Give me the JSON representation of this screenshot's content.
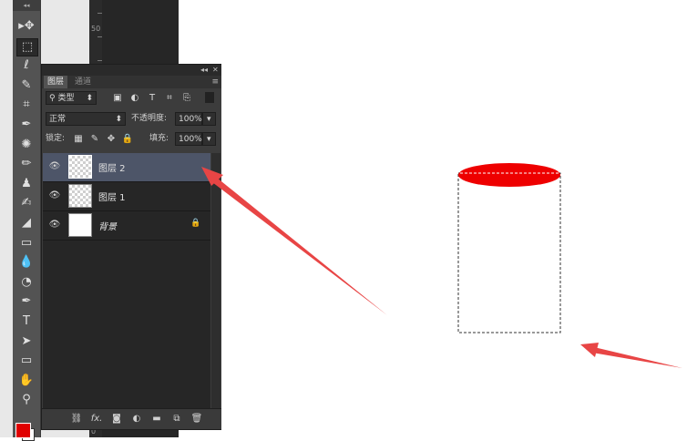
{
  "ruler": {
    "label": "50",
    "label_bottom": "0"
  },
  "toolbar": {
    "grip": "◂◂",
    "tools": [
      {
        "name": "move-tool",
        "icon": "move-icon",
        "glyph": "▸✥"
      },
      {
        "name": "marquee-tool",
        "icon": "rect-marquee-icon",
        "glyph": "⬚",
        "active": true
      },
      {
        "name": "lasso-tool",
        "icon": "lasso-icon",
        "glyph": "ℓ"
      },
      {
        "name": "quick-select-tool",
        "icon": "quick-select-icon",
        "glyph": "✎"
      },
      {
        "name": "crop-tool",
        "icon": "crop-icon",
        "glyph": "⌗"
      },
      {
        "name": "eyedropper-tool",
        "icon": "eyedropper-icon",
        "glyph": "✒"
      },
      {
        "name": "healing-tool",
        "icon": "healing-icon",
        "glyph": "✺"
      },
      {
        "name": "brush-tool",
        "icon": "brush-icon",
        "glyph": "✏"
      },
      {
        "name": "stamp-tool",
        "icon": "stamp-icon",
        "glyph": "♟"
      },
      {
        "name": "history-brush-tool",
        "icon": "history-brush-icon",
        "glyph": "✍"
      },
      {
        "name": "eraser-tool",
        "icon": "eraser-icon",
        "glyph": "◢"
      },
      {
        "name": "gradient-tool",
        "icon": "gradient-icon",
        "glyph": "▭"
      },
      {
        "name": "blur-tool",
        "icon": "blur-icon",
        "glyph": "💧"
      },
      {
        "name": "dodge-tool",
        "icon": "dodge-icon",
        "glyph": "◔"
      },
      {
        "name": "pen-tool",
        "icon": "pen-icon",
        "glyph": "✒"
      },
      {
        "name": "type-tool",
        "icon": "type-icon",
        "glyph": "T"
      },
      {
        "name": "path-select-tool",
        "icon": "path-select-icon",
        "glyph": "➤"
      },
      {
        "name": "shape-tool",
        "icon": "shape-icon",
        "glyph": "▭"
      },
      {
        "name": "hand-tool",
        "icon": "hand-icon",
        "glyph": "✋"
      },
      {
        "name": "zoom-tool",
        "icon": "zoom-icon",
        "glyph": "⚲"
      }
    ],
    "fg_color": "#e00000",
    "bg_color": "#ffffff"
  },
  "panel": {
    "top_controls": {
      "collapse": "◂◂",
      "close": "✕"
    },
    "tabs": [
      {
        "label": "图层",
        "active": true
      },
      {
        "label": "通道",
        "active": false
      }
    ],
    "menu_icon": "≡",
    "filter": {
      "kind_label": "类型",
      "icons": [
        "image-filter-icon",
        "adjust-filter-icon",
        "type-filter-icon",
        "shape-filter-icon",
        "smart-filter-icon"
      ]
    },
    "blend_mode": "正常",
    "opacity_label": "不透明度:",
    "opacity_value": "100%",
    "lock_label": "锁定:",
    "fill_label": "填充:",
    "fill_value": "100%",
    "layers": [
      {
        "name": "图层 2",
        "thumb": "checker",
        "selected": true,
        "visible": true,
        "locked": false,
        "italic": false
      },
      {
        "name": "图层 1",
        "thumb": "checker",
        "selected": false,
        "visible": true,
        "locked": false,
        "italic": false
      },
      {
        "name": "背景",
        "thumb": "white",
        "selected": false,
        "visible": true,
        "locked": true,
        "italic": true
      }
    ],
    "bottom_icons": [
      "link-icon",
      "fx-icon",
      "mask-icon",
      "adjustment-icon",
      "folder-icon",
      "new-layer-icon",
      "trash-icon"
    ],
    "fx_label": "fx."
  },
  "canvas": {
    "ellipse_color": "#ee0000",
    "arrow_color": "#e84545"
  }
}
